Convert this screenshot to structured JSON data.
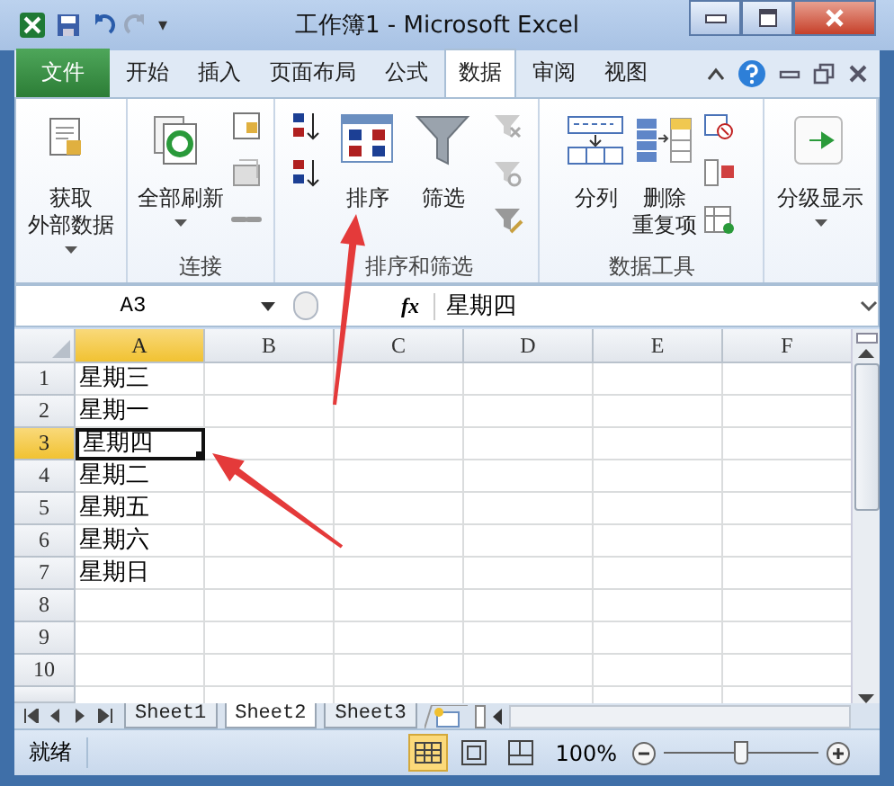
{
  "window": {
    "title": "工作簿1  -  Microsoft Excel"
  },
  "quick_access": [
    "▾"
  ],
  "tabs": [
    {
      "label": "文件",
      "kind": "file",
      "selected": false
    },
    {
      "label": "开始",
      "kind": "tab",
      "selected": false
    },
    {
      "label": "插入",
      "kind": "tab",
      "selected": false
    },
    {
      "label": "页面布局",
      "kind": "tab",
      "selected": false
    },
    {
      "label": "公式",
      "kind": "tab",
      "selected": false
    },
    {
      "label": "数据",
      "kind": "tab",
      "selected": true
    },
    {
      "label": "审阅",
      "kind": "tab",
      "selected": false
    },
    {
      "label": "视图",
      "kind": "tab",
      "selected": false
    }
  ],
  "ribbon_groups": [
    {
      "items": [
        {
          "kind": "large",
          "lines": [
            "获取",
            "外部数据"
          ],
          "dropdown": true
        }
      ]
    },
    {
      "label": "连接",
      "items": [
        {
          "kind": "large",
          "lines": [
            "全部刷新"
          ],
          "dropdown": true
        },
        {
          "kind": "smalls"
        }
      ]
    },
    {
      "label": "排序和筛选",
      "items": [
        {
          "kind": "smalls"
        },
        {
          "kind": "large",
          "lines": [
            "排序"
          ],
          "dropdown": false
        },
        {
          "kind": "large",
          "lines": [
            "筛选"
          ],
          "dropdown": false
        },
        {
          "kind": "smalls"
        }
      ]
    },
    {
      "label": "数据工具",
      "items": [
        {
          "kind": "large",
          "lines": [
            "分列"
          ],
          "dropdown": false
        },
        {
          "kind": "large",
          "lines": [
            "删除",
            "重复项"
          ],
          "dropdown": false
        },
        {
          "kind": "smalls"
        }
      ]
    },
    {
      "items": [
        {
          "kind": "large",
          "lines": [
            "分级显示"
          ],
          "dropdown": true
        }
      ]
    }
  ],
  "formula_bar": {
    "name_box": "A3",
    "fx": "fx",
    "value": "星期四"
  },
  "columns": [
    {
      "label": "A",
      "selected": true
    },
    {
      "label": "B",
      "selected": false
    },
    {
      "label": "C",
      "selected": false
    },
    {
      "label": "D",
      "selected": false
    },
    {
      "label": "E",
      "selected": false
    },
    {
      "label": "F",
      "selected": false
    }
  ],
  "rows": [
    {
      "label": "1",
      "selected": false,
      "cells": [
        "星期三"
      ]
    },
    {
      "label": "2",
      "selected": false,
      "cells": [
        "星期一"
      ]
    },
    {
      "label": "3",
      "selected": true,
      "cells": [
        "星期四"
      ]
    },
    {
      "label": "4",
      "selected": false,
      "cells": [
        "星期二"
      ]
    },
    {
      "label": "5",
      "selected": false,
      "cells": [
        "星期五"
      ]
    },
    {
      "label": "6",
      "selected": false,
      "cells": [
        "星期六"
      ]
    },
    {
      "label": "7",
      "selected": false,
      "cells": [
        "星期日"
      ]
    },
    {
      "label": "8",
      "selected": false,
      "cells": []
    },
    {
      "label": "9",
      "selected": false,
      "cells": []
    },
    {
      "label": "10",
      "selected": false,
      "cells": []
    }
  ],
  "sheet_tabs": [
    {
      "label": "Sheet1",
      "selected": false
    },
    {
      "label": "Sheet2",
      "selected": true
    },
    {
      "label": "Sheet3",
      "selected": false
    }
  ],
  "status_bar": {
    "text": "就绪",
    "views": [
      {
        "kind": "normal",
        "selected": true
      },
      {
        "kind": "layout",
        "selected": false
      },
      {
        "kind": "pagebreak",
        "selected": false
      }
    ],
    "zoom": "100%",
    "level": 0.5
  }
}
